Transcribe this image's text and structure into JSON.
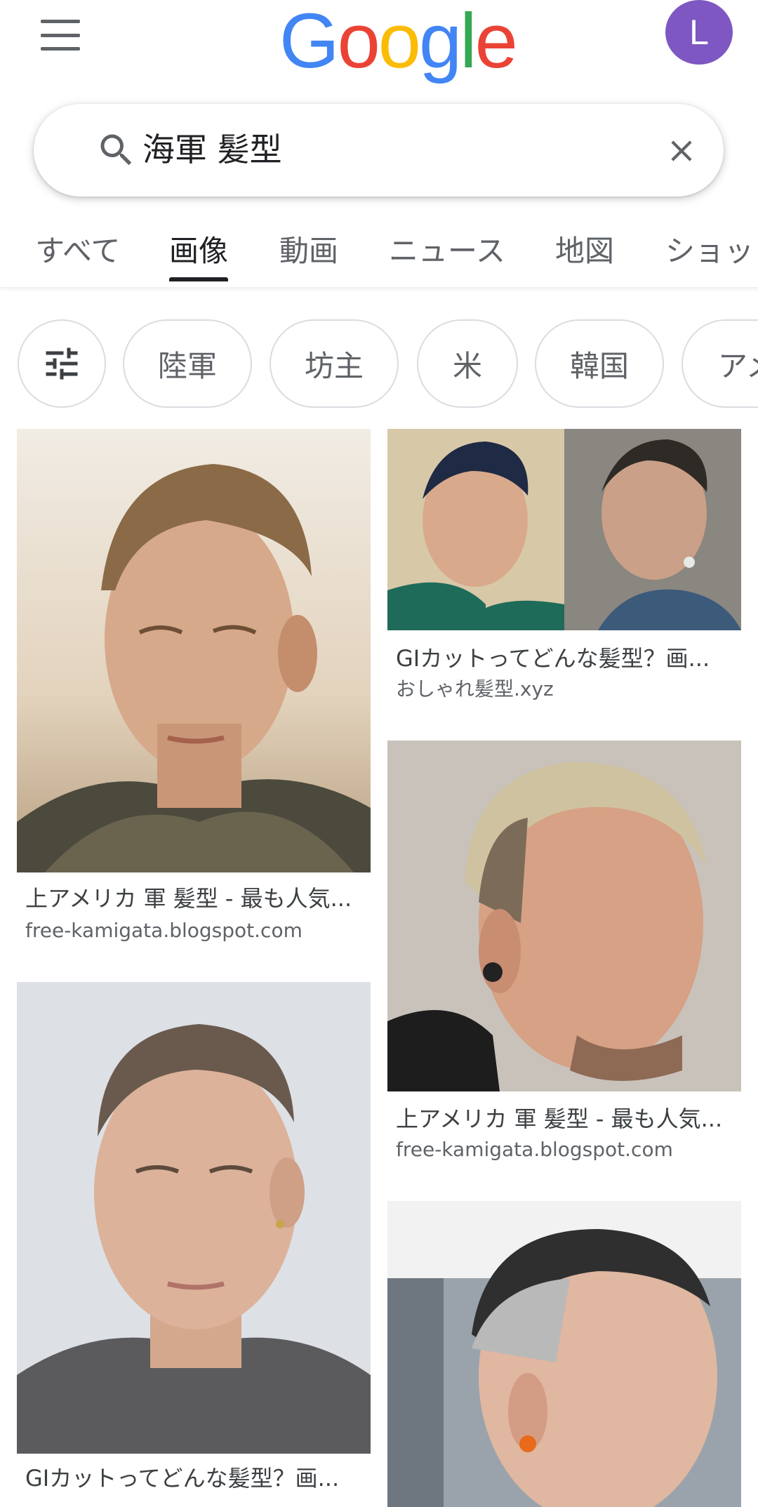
{
  "header": {
    "logo_letters": [
      "G",
      "o",
      "o",
      "g",
      "l",
      "e"
    ],
    "logo_colors": [
      "#4285F4",
      "#EA4335",
      "#FBBC05",
      "#4285F4",
      "#34A853",
      "#EA4335"
    ],
    "avatar_letter": "L",
    "avatar_color": "#7E57C2"
  },
  "search": {
    "query": "海軍 髪型"
  },
  "tabs": [
    "すべて",
    "画像",
    "動画",
    "ニュース",
    "地図",
    "ショッ"
  ],
  "active_tab": "画像",
  "chips": [
    "陸軍",
    "坊主",
    "米",
    "韓国",
    "アメ"
  ],
  "results": [
    {
      "title": "上アメリカ 軍 髪型 - 最も人気...",
      "source": "free-kamigata.blogspot.com"
    },
    {
      "title": "GIカットってどんな髪型？画...",
      "source": "おしゃれ髪型.xyz"
    },
    {
      "title": "上アメリカ 軍 髪型 - 最も人気...",
      "source": "free-kamigata.blogspot.com"
    },
    {
      "title": "GIカットってどんな髪型？画..."
    },
    {}
  ]
}
